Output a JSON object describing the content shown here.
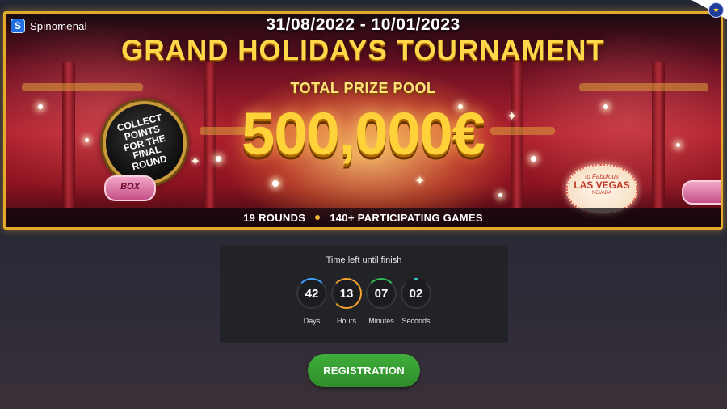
{
  "banner": {
    "brand": "Spinomenal",
    "brand_logo_letter": "S",
    "dates": "31/08/2022 - 10/01/2023",
    "title": "GRAND HOLIDAYS TOURNAMENT",
    "prize_label": "TOTAL PRIZE POOL",
    "prize_amount": "500,000€",
    "badge_text": "COLLECT POINTS FOR THE FINAL ROUND",
    "left_sign": "BOX",
    "vegas_sign": {
      "top": "to Fabulous",
      "main": "LAS VEGAS",
      "sub": "NEVADA"
    },
    "stats": [
      "19 ROUNDS",
      "140+ PARTICIPATING GAMES"
    ],
    "colors": {
      "border": "#e2a92b",
      "title": "#ffd84a",
      "background": "#b0202e"
    }
  },
  "language_icon": "eu-flag-icon",
  "countdown": {
    "title": "Time left until finish",
    "units": [
      {
        "value": "42",
        "label": "Days",
        "color": "#3da0ff"
      },
      {
        "value": "13",
        "label": "Hours",
        "color": "#f7a431"
      },
      {
        "value": "07",
        "label": "Minutes",
        "color": "#2fbf57"
      },
      {
        "value": "02",
        "label": "Seconds",
        "color": "#2fc1b8"
      }
    ]
  },
  "registration": {
    "label": "REGISTRATION",
    "color": "#3fae3a"
  }
}
